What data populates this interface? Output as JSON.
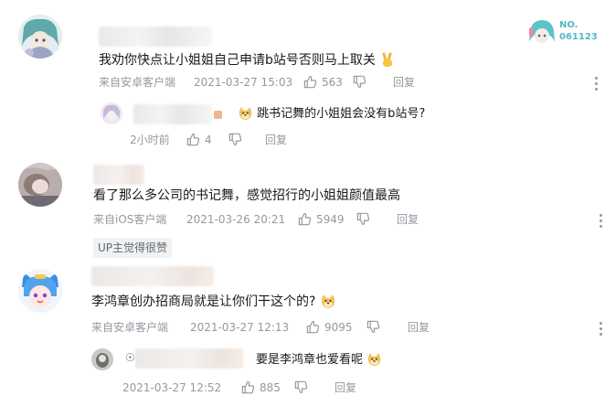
{
  "comments": [
    {
      "text": "我劝你快点让小姐姐自己申请b站号否则马上取关",
      "source": "来自安卓客户端",
      "time": "2021-03-27 15:03",
      "likes": "563",
      "reply_label": "回复",
      "badge_top": "NO.",
      "badge_num": "061123",
      "reply": {
        "text": "跳书记舞的小姐姐会没有b站号?",
        "time_ago": "2小时前",
        "likes": "4",
        "reply_label": "回复"
      }
    },
    {
      "text": "看了那么多公司的书记舞，感觉招行的小姐姐颜值最高",
      "source": "来自iOS客户端",
      "time": "2021-03-26 20:21",
      "likes": "5949",
      "reply_label": "回复",
      "tag": "UP主觉得很赞"
    },
    {
      "text": "李鸿章创办招商局就是让你们干这个的?",
      "source": "来自安卓客户端",
      "time": "2021-03-27 12:13",
      "likes": "9095",
      "reply_label": "回复",
      "reply": {
        "text": "要是李鸿章也爱看呢",
        "time": "2021-03-27 12:52",
        "likes": "885",
        "reply_label": "回复"
      }
    }
  ],
  "colors": {
    "meta": "#9499a0",
    "text": "#18191c",
    "tag_bg": "#f1f2f3",
    "badge": "#57b6c7"
  }
}
